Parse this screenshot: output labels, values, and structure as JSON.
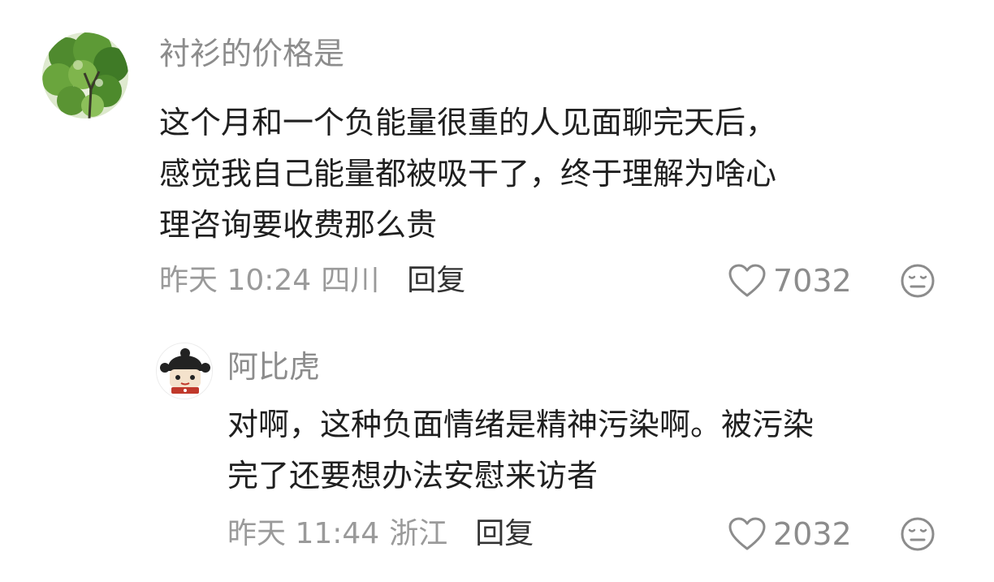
{
  "comments": [
    {
      "username": "衬衫的价格是",
      "lines": [
        "这个月和一个负能量很重的人见面聊完天后，",
        "感觉我自己能量都被吸干了，终于理解为啥心",
        "理咨询要收费那么贵"
      ],
      "time": "昨天 10:24",
      "location": "四川",
      "reply_label": "回复",
      "likes": "7032",
      "avatar_icon": "tree-photo-avatar",
      "reaction_icon": "neutral-face-icon"
    }
  ],
  "reply": {
    "username": "阿比虎",
    "lines": [
      "对啊，这种负面情绪是精神污染啊。被污染",
      "完了还要想办法安慰来访者"
    ],
    "time": "昨天 11:44",
    "location": "浙江",
    "reply_label": "回复",
    "likes": "2032",
    "avatar_icon": "cartoon-character-avatar",
    "reaction_icon": "neutral-face-icon"
  },
  "colors": {
    "text": "#1f1f1f",
    "muted": "#9a9a9a",
    "username": "#8c8c8c"
  }
}
